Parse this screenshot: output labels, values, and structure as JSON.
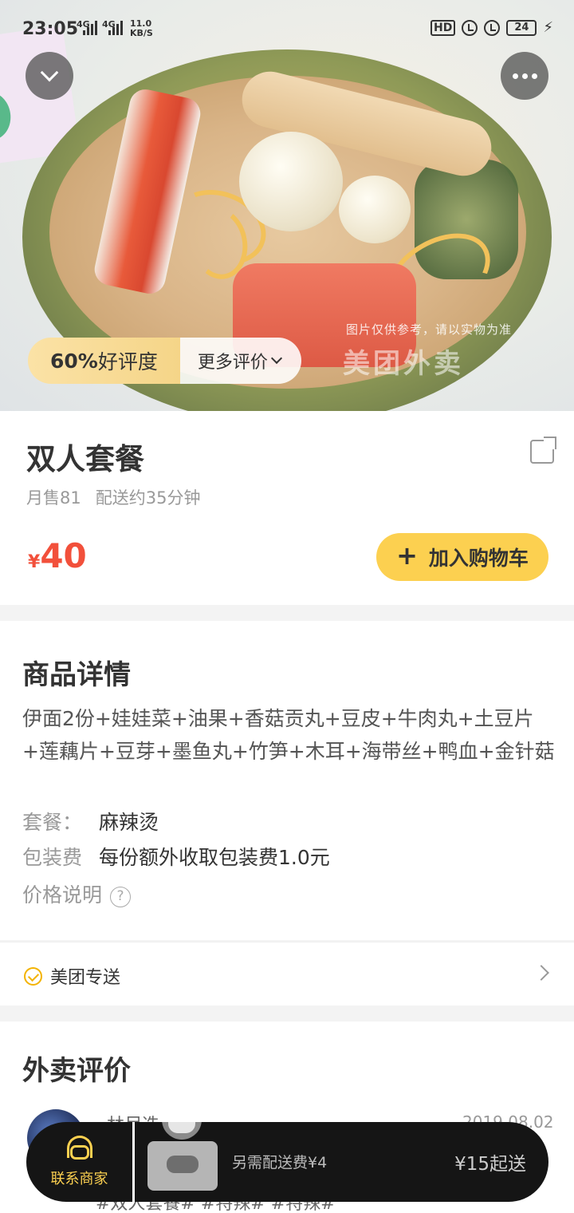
{
  "status_bar": {
    "time": "23:05",
    "net1": "4G",
    "net2": "4G",
    "speed_value": "11.0",
    "speed_unit": "KB/S",
    "hd_label": "HD",
    "battery": "24"
  },
  "hero": {
    "watermark": "图片仅供参考，请以实物为准",
    "watermark_logo": "美团外卖",
    "rating_value": "60%",
    "rating_label": "好评度",
    "more_reviews_label": "更多评价"
  },
  "product": {
    "name": "双人套餐",
    "monthly_sales": "月售81",
    "delivery_time": "配送约35分钟",
    "currency": "¥",
    "price": "40",
    "add_to_cart_label": "加入购物车"
  },
  "details": {
    "section_title": "商品详情",
    "description": "伊面2份+娃娃菜+油果+香菇贡丸+豆皮+牛肉丸+土豆片+莲藕片+豆芽+墨鱼丸+竹笋+木耳+海带丝+鸭血+金针菇",
    "set_meal_label": "套餐：",
    "set_meal_value": "麻辣烫",
    "packaging_label": "包装费",
    "packaging_value": "每份额外收取包装费1.0元",
    "price_note_label": "价格说明",
    "question_mark": "?"
  },
  "delivery": {
    "label": "美团专送"
  },
  "reviews": {
    "section_title": "外卖评价",
    "reviewer_name": "林尽迭",
    "date": "2019.08.02",
    "tags": "#双人套餐# #特辣# #特辣#"
  },
  "bottom_bar": {
    "contact_label": "联系商家",
    "delivery_fee": "另需配送费¥4",
    "minimum_order": "¥15起送"
  },
  "colors": {
    "accent_yellow": "#fcd050",
    "price_red": "#f2503b",
    "dark_bar": "#151515"
  }
}
